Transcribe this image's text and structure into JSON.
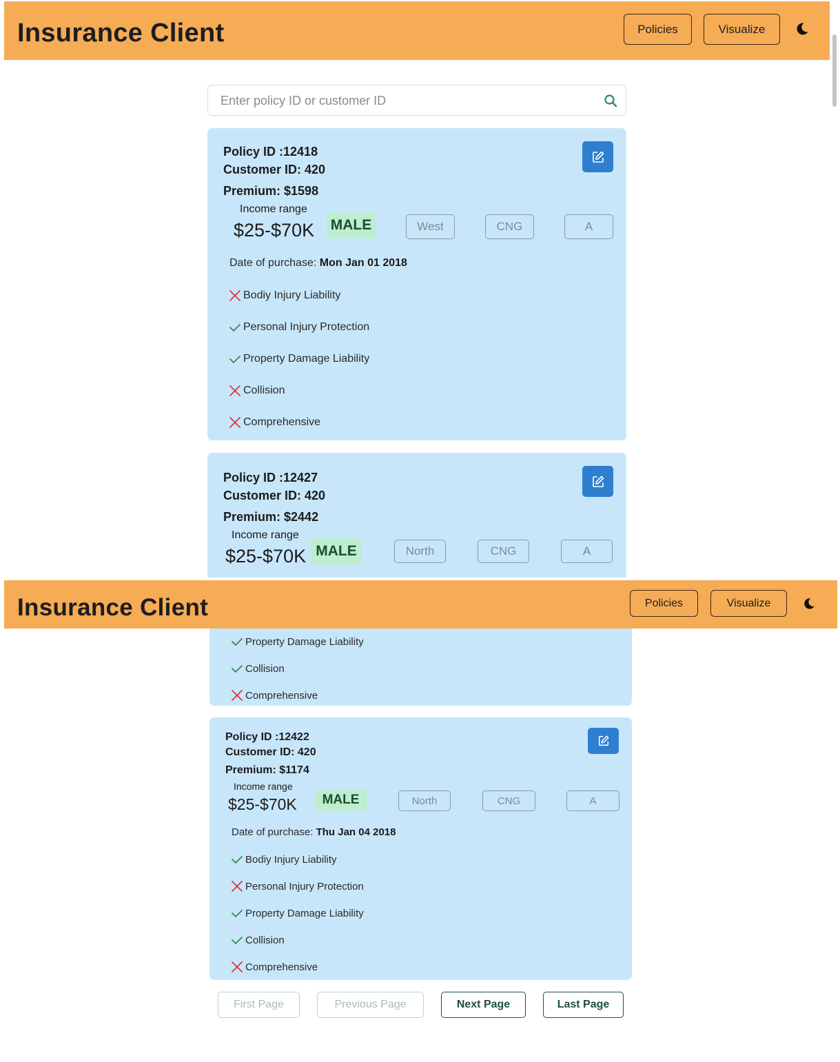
{
  "app": {
    "title": "Insurance Client",
    "nav": {
      "policies": "Policies",
      "visualize": "Visualize",
      "theme_icon": "moon-icon"
    }
  },
  "search": {
    "placeholder": "Enter policy ID or customer ID",
    "value": "",
    "icon": "search-icon"
  },
  "labels": {
    "income_range": "Income range",
    "date_of_purchase": "Date of purchase:"
  },
  "cards": [
    {
      "policy_id": "Policy ID :12418",
      "customer_id": "Customer ID: 420",
      "premium": "Premium: $1598",
      "income": "$25-$70K",
      "gender": "MALE",
      "region": "West",
      "fuel": "CNG",
      "segment": "A",
      "date": "Mon Jan 01 2018",
      "coverages": [
        {
          "label": "Bodiy Injury Liability",
          "covered": false
        },
        {
          "label": "Personal Injury Protection",
          "covered": true
        },
        {
          "label": "Property Damage Liability",
          "covered": true
        },
        {
          "label": "Collision",
          "covered": false
        },
        {
          "label": "Comprehensive",
          "covered": false
        }
      ]
    },
    {
      "policy_id": "Policy ID :12427",
      "customer_id": "Customer ID: 420",
      "premium": "Premium: $2442",
      "income": "$25-$70K",
      "gender": "MALE",
      "region": "North",
      "fuel": "CNG",
      "segment": "A"
    },
    {
      "coverages": [
        {
          "label": "Property Damage Liability",
          "covered": true
        },
        {
          "label": "Collision",
          "covered": true
        },
        {
          "label": "Comprehensive",
          "covered": false
        }
      ]
    },
    {
      "policy_id": "Policy ID :12422",
      "customer_id": "Customer ID: 420",
      "premium": "Premium: $1174",
      "income": "$25-$70K",
      "gender": "MALE",
      "region": "North",
      "fuel": "CNG",
      "segment": "A",
      "date": "Thu Jan 04 2018",
      "coverages": [
        {
          "label": "Bodiy Injury Liability",
          "covered": true
        },
        {
          "label": "Personal Injury Protection",
          "covered": false
        },
        {
          "label": "Property Damage Liability",
          "covered": true
        },
        {
          "label": "Collision",
          "covered": true
        },
        {
          "label": "Comprehensive",
          "covered": false
        }
      ]
    }
  ],
  "pagination": {
    "first": "First Page",
    "previous": "Previous Page",
    "next": "Next Page",
    "last": "Last Page"
  },
  "colors": {
    "navbar": "#f6ab55",
    "card": "#c8e6fa",
    "edit_button": "#2f7fd0",
    "check": "#2e8b57",
    "cross": "#e0353b",
    "gender_badge": "#bdeed0"
  }
}
